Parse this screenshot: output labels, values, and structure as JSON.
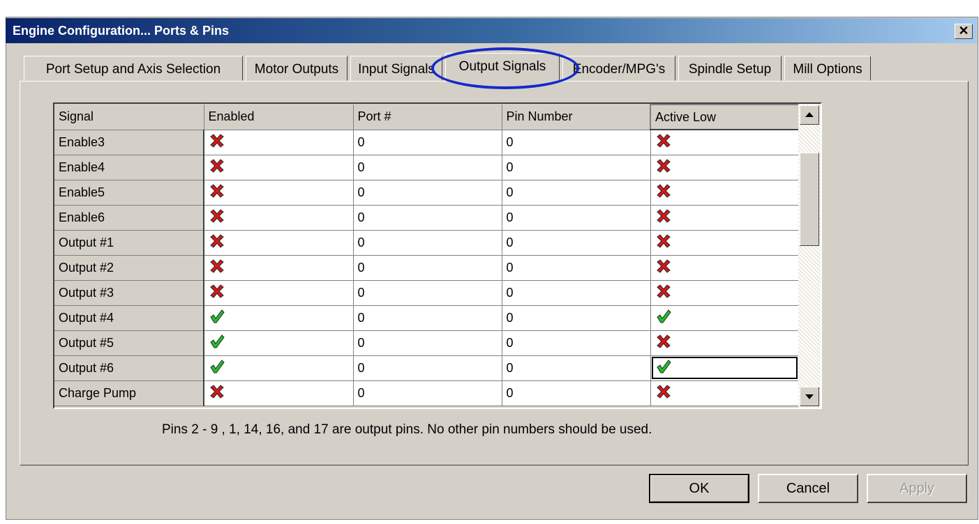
{
  "window": {
    "title": "Engine Configuration... Ports & Pins",
    "close_glyph": "✕"
  },
  "tabs": [
    {
      "label": "Port Setup and Axis Selection",
      "active": false
    },
    {
      "label": "Motor Outputs",
      "active": false
    },
    {
      "label": "Input Signals",
      "active": false
    },
    {
      "label": "Output Signals",
      "active": true
    },
    {
      "label": "Encoder/MPG's",
      "active": false
    },
    {
      "label": "Spindle Setup",
      "active": false
    },
    {
      "label": "Mill Options",
      "active": false
    }
  ],
  "table": {
    "columns": [
      "Signal",
      "Enabled",
      "Port #",
      "Pin Number",
      "Active Low"
    ],
    "rows": [
      {
        "signal": "Enable3",
        "enabled": false,
        "port": "0",
        "pin": "0",
        "active_low": false
      },
      {
        "signal": "Enable4",
        "enabled": false,
        "port": "0",
        "pin": "0",
        "active_low": false
      },
      {
        "signal": "Enable5",
        "enabled": false,
        "port": "0",
        "pin": "0",
        "active_low": false
      },
      {
        "signal": "Enable6",
        "enabled": false,
        "port": "0",
        "pin": "0",
        "active_low": false
      },
      {
        "signal": "Output #1",
        "enabled": false,
        "port": "0",
        "pin": "0",
        "active_low": false
      },
      {
        "signal": "Output #2",
        "enabled": false,
        "port": "0",
        "pin": "0",
        "active_low": false
      },
      {
        "signal": "Output #3",
        "enabled": false,
        "port": "0",
        "pin": "0",
        "active_low": false
      },
      {
        "signal": "Output #4",
        "enabled": true,
        "port": "0",
        "pin": "0",
        "active_low": true
      },
      {
        "signal": "Output #5",
        "enabled": true,
        "port": "0",
        "pin": "0",
        "active_low": false
      },
      {
        "signal": "Output #6",
        "enabled": true,
        "port": "0",
        "pin": "0",
        "active_low": true
      },
      {
        "signal": "Charge Pump",
        "enabled": false,
        "port": "0",
        "pin": "0",
        "active_low": false
      }
    ]
  },
  "note": "Pins 2 - 9 , 1, 14, 16, and 17 are output pins. No  other pin numbers should be used.",
  "buttons": {
    "ok": "OK",
    "cancel": "Cancel",
    "apply": "Apply"
  },
  "icons": {
    "true_icon": "green-check-icon",
    "false_icon": "red-x-icon"
  },
  "colors": {
    "check_green": "#22c02a",
    "x_red": "#d81818",
    "highlight_blue": "#1529c8"
  }
}
